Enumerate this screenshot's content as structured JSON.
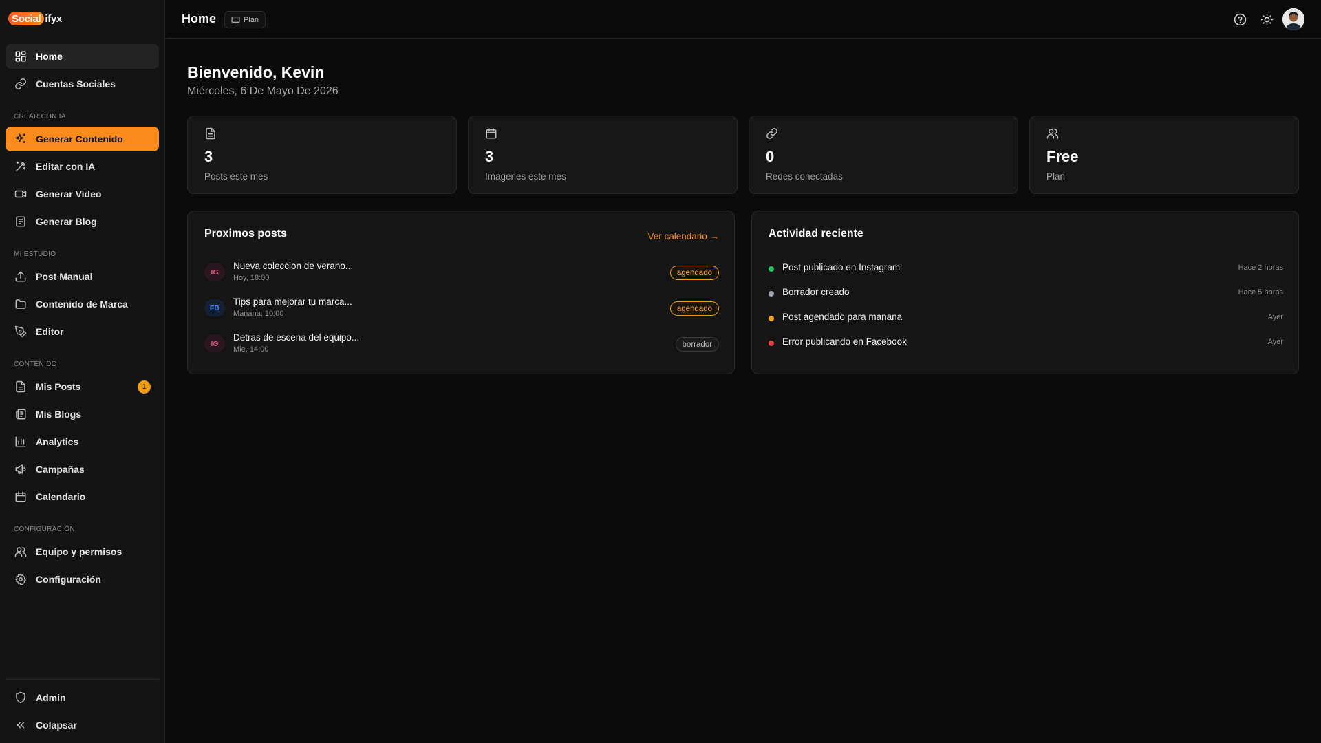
{
  "brand": {
    "logo_prefix": "Social",
    "logo_suffix": "ifyx",
    "accent": "#fb8c1b"
  },
  "header": {
    "title": "Home",
    "plan_label": "Plan"
  },
  "sidebar": {
    "primary": [
      {
        "label": "Home",
        "icon": "grid-icon"
      },
      {
        "label": "Cuentas Sociales",
        "icon": "link-icon"
      }
    ],
    "sections": [
      {
        "label": "CREAR CON IA",
        "items": [
          {
            "label": "Generar Contenido",
            "icon": "sparkles-icon"
          },
          {
            "label": "Editar con IA",
            "icon": "wand-icon"
          },
          {
            "label": "Generar Video",
            "icon": "video-icon"
          },
          {
            "label": "Generar Blog",
            "icon": "document-icon"
          }
        ]
      },
      {
        "label": "MI ESTUDIO",
        "items": [
          {
            "label": "Post Manual",
            "icon": "upload-icon"
          },
          {
            "label": "Contenido de Marca",
            "icon": "folder-icon"
          },
          {
            "label": "Editor",
            "icon": "pen-tool-icon"
          }
        ]
      },
      {
        "label": "CONTENIDO",
        "items": [
          {
            "label": "Mis Posts",
            "icon": "file-text-icon",
            "badge": "1"
          },
          {
            "label": "Mis Blogs",
            "icon": "newspaper-icon"
          },
          {
            "label": "Analytics",
            "icon": "bar-chart-icon"
          },
          {
            "label": "Campañas",
            "icon": "megaphone-icon"
          },
          {
            "label": "Calendario",
            "icon": "calendar-icon"
          }
        ]
      },
      {
        "label": "CONFIGURACIÓN",
        "items": [
          {
            "label": "Equipo y permisos",
            "icon": "users-icon"
          },
          {
            "label": "Configuración",
            "icon": "gear-icon"
          }
        ]
      }
    ],
    "footer": [
      {
        "label": "Admin",
        "icon": "shield-icon"
      },
      {
        "label": "Colapsar",
        "icon": "chevrons-left-icon"
      }
    ]
  },
  "main": {
    "welcome": "Bienvenido, Kevin",
    "date": "Miércoles, 6 De Mayo De 2026",
    "stats": [
      {
        "value": "3",
        "label": "Posts este mes",
        "icon": "file-icon"
      },
      {
        "value": "3",
        "label": "Imagenes este mes",
        "icon": "calendar-icon"
      },
      {
        "value": "0",
        "label": "Redes conectadas",
        "icon": "link-icon"
      },
      {
        "value": "Free",
        "label": "Plan",
        "icon": "users-icon"
      }
    ],
    "upcoming": {
      "title": "Proximos posts",
      "link": "Ver calendario →",
      "posts": [
        {
          "network": "IG",
          "title": "Nueva coleccion de verano...",
          "time": "Hoy, 18:00",
          "status": "agendado"
        },
        {
          "network": "FB",
          "title": "Tips para mejorar tu marca...",
          "time": "Manana, 10:00",
          "status": "agendado"
        },
        {
          "network": "IG",
          "title": "Detras de escena del equipo...",
          "time": "Mie, 14:00",
          "status": "borrador"
        }
      ]
    },
    "activity": {
      "title": "Actividad reciente",
      "items": [
        {
          "text": "Post publicado en Instagram",
          "time": "Hace 2 horas",
          "color": "#22c55e"
        },
        {
          "text": "Borrador creado",
          "time": "Hace 5 horas",
          "color": "#9ca3af"
        },
        {
          "text": "Post agendado para manana",
          "time": "Ayer",
          "color": "#f59e0b"
        },
        {
          "text": "Error publicando en Facebook",
          "time": "Ayer",
          "color": "#ef4444"
        }
      ]
    }
  }
}
